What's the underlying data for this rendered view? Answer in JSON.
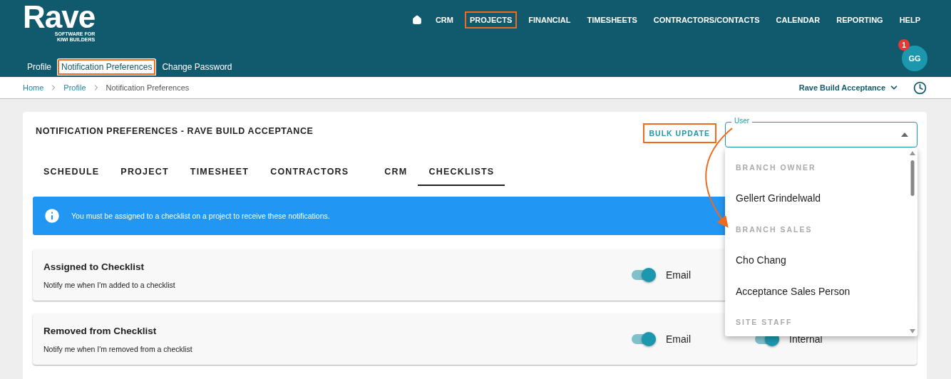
{
  "app": {
    "logo": "Rave",
    "tagline": [
      "SOFTWARE FOR",
      "KIWI BUILDERS"
    ]
  },
  "nav": [
    {
      "label": "CRM",
      "annotated": false
    },
    {
      "label": "PROJECTS",
      "annotated": true
    },
    {
      "label": "FINANCIAL",
      "annotated": false
    },
    {
      "label": "TIMESHEETS",
      "annotated": false
    },
    {
      "label": "CONTRACTORS/CONTACTS",
      "annotated": false
    },
    {
      "label": "CALENDAR",
      "annotated": false
    },
    {
      "label": "REPORTING",
      "annotated": false
    },
    {
      "label": "HELP",
      "annotated": false
    }
  ],
  "profile_tabs": [
    {
      "label": "Profile",
      "selected": false,
      "annotated": false
    },
    {
      "label": "Notification Preferences",
      "selected": true,
      "annotated": true
    },
    {
      "label": "Change Password",
      "selected": false,
      "annotated": false
    }
  ],
  "avatar": {
    "initials": "GG",
    "badge": "1"
  },
  "breadcrumbs": [
    {
      "label": "Home",
      "link": true
    },
    {
      "label": "Profile",
      "link": true
    },
    {
      "label": "Notification Preferences",
      "link": false
    }
  ],
  "project_selector": {
    "label": "Rave Build Acceptance"
  },
  "card": {
    "title": "NOTIFICATION PREFERENCES - RAVE BUILD ACCEPTANCE",
    "bulk_update": {
      "label": "BULK UPDATE",
      "annotated": true
    },
    "user_field": {
      "label": "User",
      "expanded": true,
      "annotated": true
    },
    "user_options": [
      {
        "kind": "group",
        "label": "BRANCH OWNER"
      },
      {
        "kind": "option",
        "label": "Gellert Grindelwald"
      },
      {
        "kind": "group",
        "label": "BRANCH SALES"
      },
      {
        "kind": "option",
        "label": "Cho Chang"
      },
      {
        "kind": "option",
        "label": "Acceptance Sales Person"
      },
      {
        "kind": "group",
        "label": "SITE STAFF"
      }
    ],
    "tabs": [
      {
        "label": "SCHEDULE",
        "selected": false
      },
      {
        "label": "PROJECT",
        "selected": false
      },
      {
        "label": "TIMESHEET",
        "selected": false
      },
      {
        "label": "CONTRACTORS",
        "selected": false
      },
      {
        "label": "CRM",
        "selected": false
      },
      {
        "label": "CHECKLISTS",
        "selected": true
      }
    ],
    "info": "You must be assigned to a checklist on a project to receive these notifications.",
    "rows": [
      {
        "title": "Assigned to Checklist",
        "description": "Notify me when I'm added to a checklist",
        "toggles": [
          {
            "label": "Email",
            "on": true
          }
        ]
      },
      {
        "title": "Removed from Checklist",
        "description": "Notify me when I'm removed from a checklist",
        "toggles": [
          {
            "label": "Email",
            "on": true
          },
          {
            "label": "Internal",
            "on": true
          }
        ]
      }
    ]
  }
}
